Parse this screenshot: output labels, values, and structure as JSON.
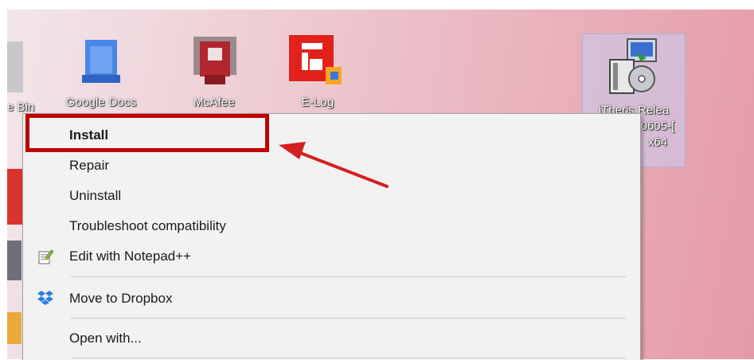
{
  "desktop": {
    "icons": [
      {
        "label": "e Bin",
        "icon": "recycle-bin-icon"
      },
      {
        "label": "Google Docs",
        "icon": "google-docs-icon"
      },
      {
        "label": "McAfee",
        "icon": "mcafee-icon"
      },
      {
        "label": "E-Log",
        "icon": "elog-icon"
      }
    ],
    "selected_icon": {
      "icon": "setup-installer-icon",
      "label_lines": [
        "iTheris Relea",
        "0605-[",
        "x64"
      ]
    }
  },
  "context_menu": {
    "items": [
      {
        "label": "Install",
        "bold": true
      },
      {
        "label": "Repair"
      },
      {
        "label": "Uninstall"
      },
      {
        "label": "Troubleshoot compatibility"
      },
      {
        "label": "Edit with Notepad++",
        "icon": "notepad-plus-plus-icon"
      },
      {
        "label": "Move to Dropbox",
        "icon": "dropbox-icon"
      },
      {
        "label": "Open with..."
      }
    ]
  },
  "annotation": {
    "color": "#c00000"
  }
}
